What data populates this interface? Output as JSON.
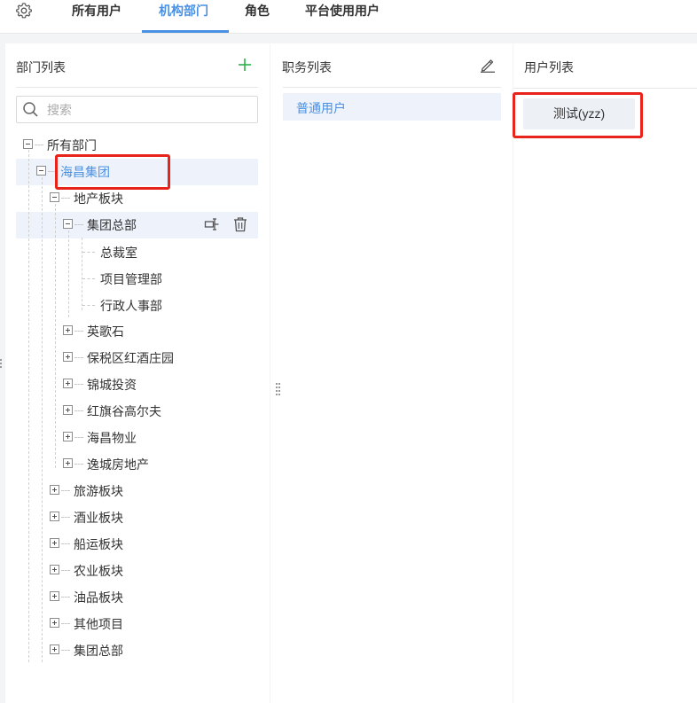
{
  "topbar": {
    "tabs": [
      {
        "label": "所有用户",
        "active": false
      },
      {
        "label": "机构部门",
        "active": true
      },
      {
        "label": "角色",
        "active": false
      },
      {
        "label": "平台使用用户",
        "active": false
      }
    ]
  },
  "dept_panel": {
    "title": "部门列表",
    "search_placeholder": "搜索",
    "tree": {
      "root": "所有部门",
      "group": "海昌集团",
      "realestate": "地产板块",
      "hq": "集团总部",
      "hq_children": [
        "总裁室",
        "项目管理部",
        "行政人事部"
      ],
      "realestate_siblings": [
        "英歌石",
        "保税区红酒庄园",
        "锦城投资",
        "红旗谷高尔夫",
        "海昌物业",
        "逸城房地产"
      ],
      "group_children": [
        "旅游板块",
        "酒业板块",
        "船运板块",
        "农业板块",
        "油品板块",
        "其他项目",
        "集团总部"
      ]
    }
  },
  "job_panel": {
    "title": "职务列表",
    "items": [
      "普通用户"
    ]
  },
  "user_panel": {
    "title": "用户列表",
    "users": [
      "测试(yzz)"
    ]
  },
  "colors": {
    "accent": "#4a90e2",
    "highlight": "#e8231c",
    "add": "#2bb24c",
    "selected_bg": "#eef3fb"
  }
}
